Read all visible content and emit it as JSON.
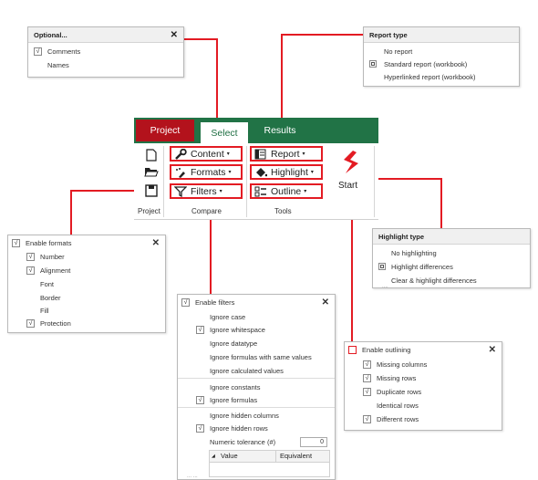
{
  "optional_panel": {
    "title": "Optional...",
    "close": "✕",
    "items": [
      {
        "label": "Comments",
        "checked": true
      },
      {
        "label": "Names",
        "checked": false
      }
    ]
  },
  "report_panel": {
    "title": "Report type",
    "items": [
      {
        "label": "No report",
        "selected": false
      },
      {
        "label": "Standard report (workbook)",
        "selected": true
      },
      {
        "label": "Hyperlinked report (workbook)",
        "selected": false
      }
    ]
  },
  "ribbon": {
    "tabs": [
      {
        "label": "Project"
      },
      {
        "label": "Select"
      },
      {
        "label": "Results"
      }
    ],
    "project_group": "Project",
    "compare_group": "Compare",
    "tools_group": "Tools",
    "buttons": {
      "content": "Content",
      "formats": "Formats",
      "filters": "Filters",
      "report": "Report",
      "highlight": "Highlight",
      "outline": "Outline",
      "start": "Start"
    },
    "caret": "▾",
    "colors": {
      "project_tab": "#b3121c",
      "select_tab_text": "#1f6f43",
      "ribbon_bg": "#217346",
      "highlight_border": "#e31b23"
    }
  },
  "formats_panel": {
    "title": "Enable formats",
    "checked": true,
    "close": "✕",
    "items": [
      {
        "label": "Number",
        "checked": true
      },
      {
        "label": "Alignment",
        "checked": true
      },
      {
        "label": "Font",
        "checked": false
      },
      {
        "label": "Border",
        "checked": false
      },
      {
        "label": "Fill",
        "checked": false
      },
      {
        "label": "Protection",
        "checked": true
      }
    ]
  },
  "highlight_panel": {
    "title": "Highlight type",
    "truncated_text": "....",
    "items": [
      {
        "label": "No highlighting",
        "selected": false
      },
      {
        "label": "Highlight differences",
        "selected": true
      },
      {
        "label": "Clear & highlight differences",
        "selected": false
      }
    ]
  },
  "filters_panel": {
    "title": "Enable filters",
    "checked": true,
    "close": "✕",
    "items": [
      {
        "label": "Ignore case",
        "checked": false
      },
      {
        "label": "Ignore whitespace",
        "checked": true
      },
      {
        "label": "Ignore datatype",
        "checked": false
      },
      {
        "label": "Ignore formulas with same values",
        "checked": false
      },
      {
        "label": "Ignore calculated values",
        "checked": false
      },
      {
        "label": "Ignore constants",
        "checked": false
      },
      {
        "label": "Ignore formulas",
        "checked": true
      },
      {
        "label": "Ignore hidden columns",
        "checked": false
      },
      {
        "label": "Ignore hidden rows",
        "checked": true
      }
    ],
    "tolerance_label": "Numeric tolerance (#)",
    "tolerance_value": "0",
    "table_headers": [
      "Value",
      "Equivalent"
    ],
    "truncated_text": "... ...",
    "checkmark": "√"
  },
  "outline_panel": {
    "title": "Enable outlining",
    "checked": false,
    "close": "✕",
    "items": [
      {
        "label": "Missing columns",
        "checked": true
      },
      {
        "label": "Missing rows",
        "checked": true
      },
      {
        "label": "Duplicate rows",
        "checked": true
      },
      {
        "label": "Identical rows",
        "checked": false
      },
      {
        "label": "Different rows",
        "checked": true
      }
    ]
  }
}
